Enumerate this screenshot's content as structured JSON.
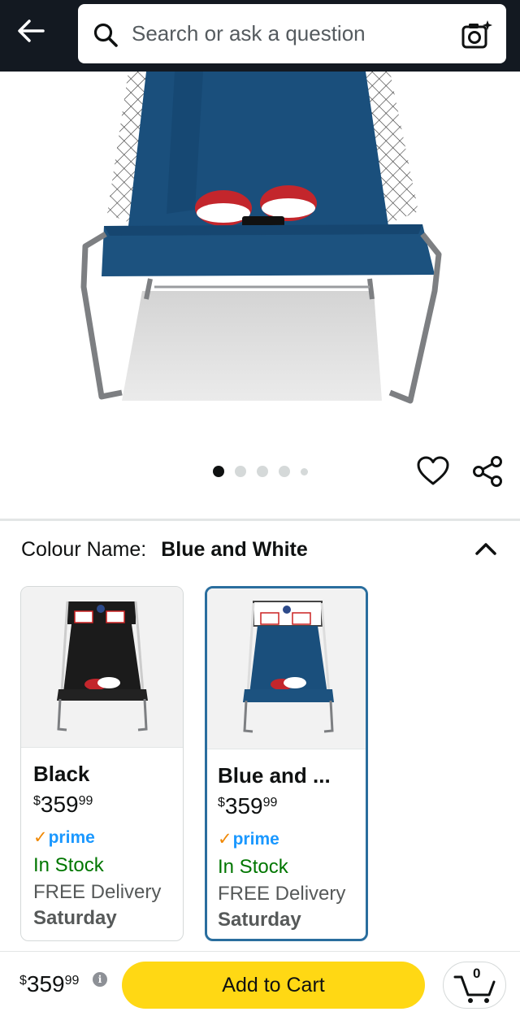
{
  "header": {
    "search_placeholder": "Search or ask a question",
    "back_icon": "back-arrow-icon",
    "camera_icon": "camera-search-icon"
  },
  "gallery": {
    "image_count": 5,
    "active_index": 0,
    "wishlist_icon": "heart-icon",
    "share_icon": "share-icon"
  },
  "colour": {
    "label": "Colour Name:",
    "value": "Blue and White"
  },
  "variants": [
    {
      "name": "Black",
      "price_symbol": "$",
      "price_whole": "359",
      "price_fraction": "99",
      "prime": "prime",
      "stock": "In Stock",
      "delivery": "FREE Delivery",
      "delivery_day": "Saturday",
      "selected": false
    },
    {
      "name": "Blue and ...",
      "price_symbol": "$",
      "price_whole": "359",
      "price_fraction": "99",
      "prime": "prime",
      "stock": "In Stock",
      "delivery": "FREE Delivery",
      "delivery_day": "Saturday",
      "selected": true
    }
  ],
  "footer": {
    "price_symbol": "$",
    "price_whole": "359",
    "price_fraction": "99",
    "info_glyph": "i",
    "add_to_cart": "Add to Cart",
    "cart_count": "0"
  },
  "colors": {
    "header_bg": "#131921",
    "add_to_cart": "#ffd814",
    "prime_blue": "#1a98ff",
    "prime_check": "#f08804",
    "in_stock": "#007600",
    "selected_border": "#2a6e9e"
  }
}
